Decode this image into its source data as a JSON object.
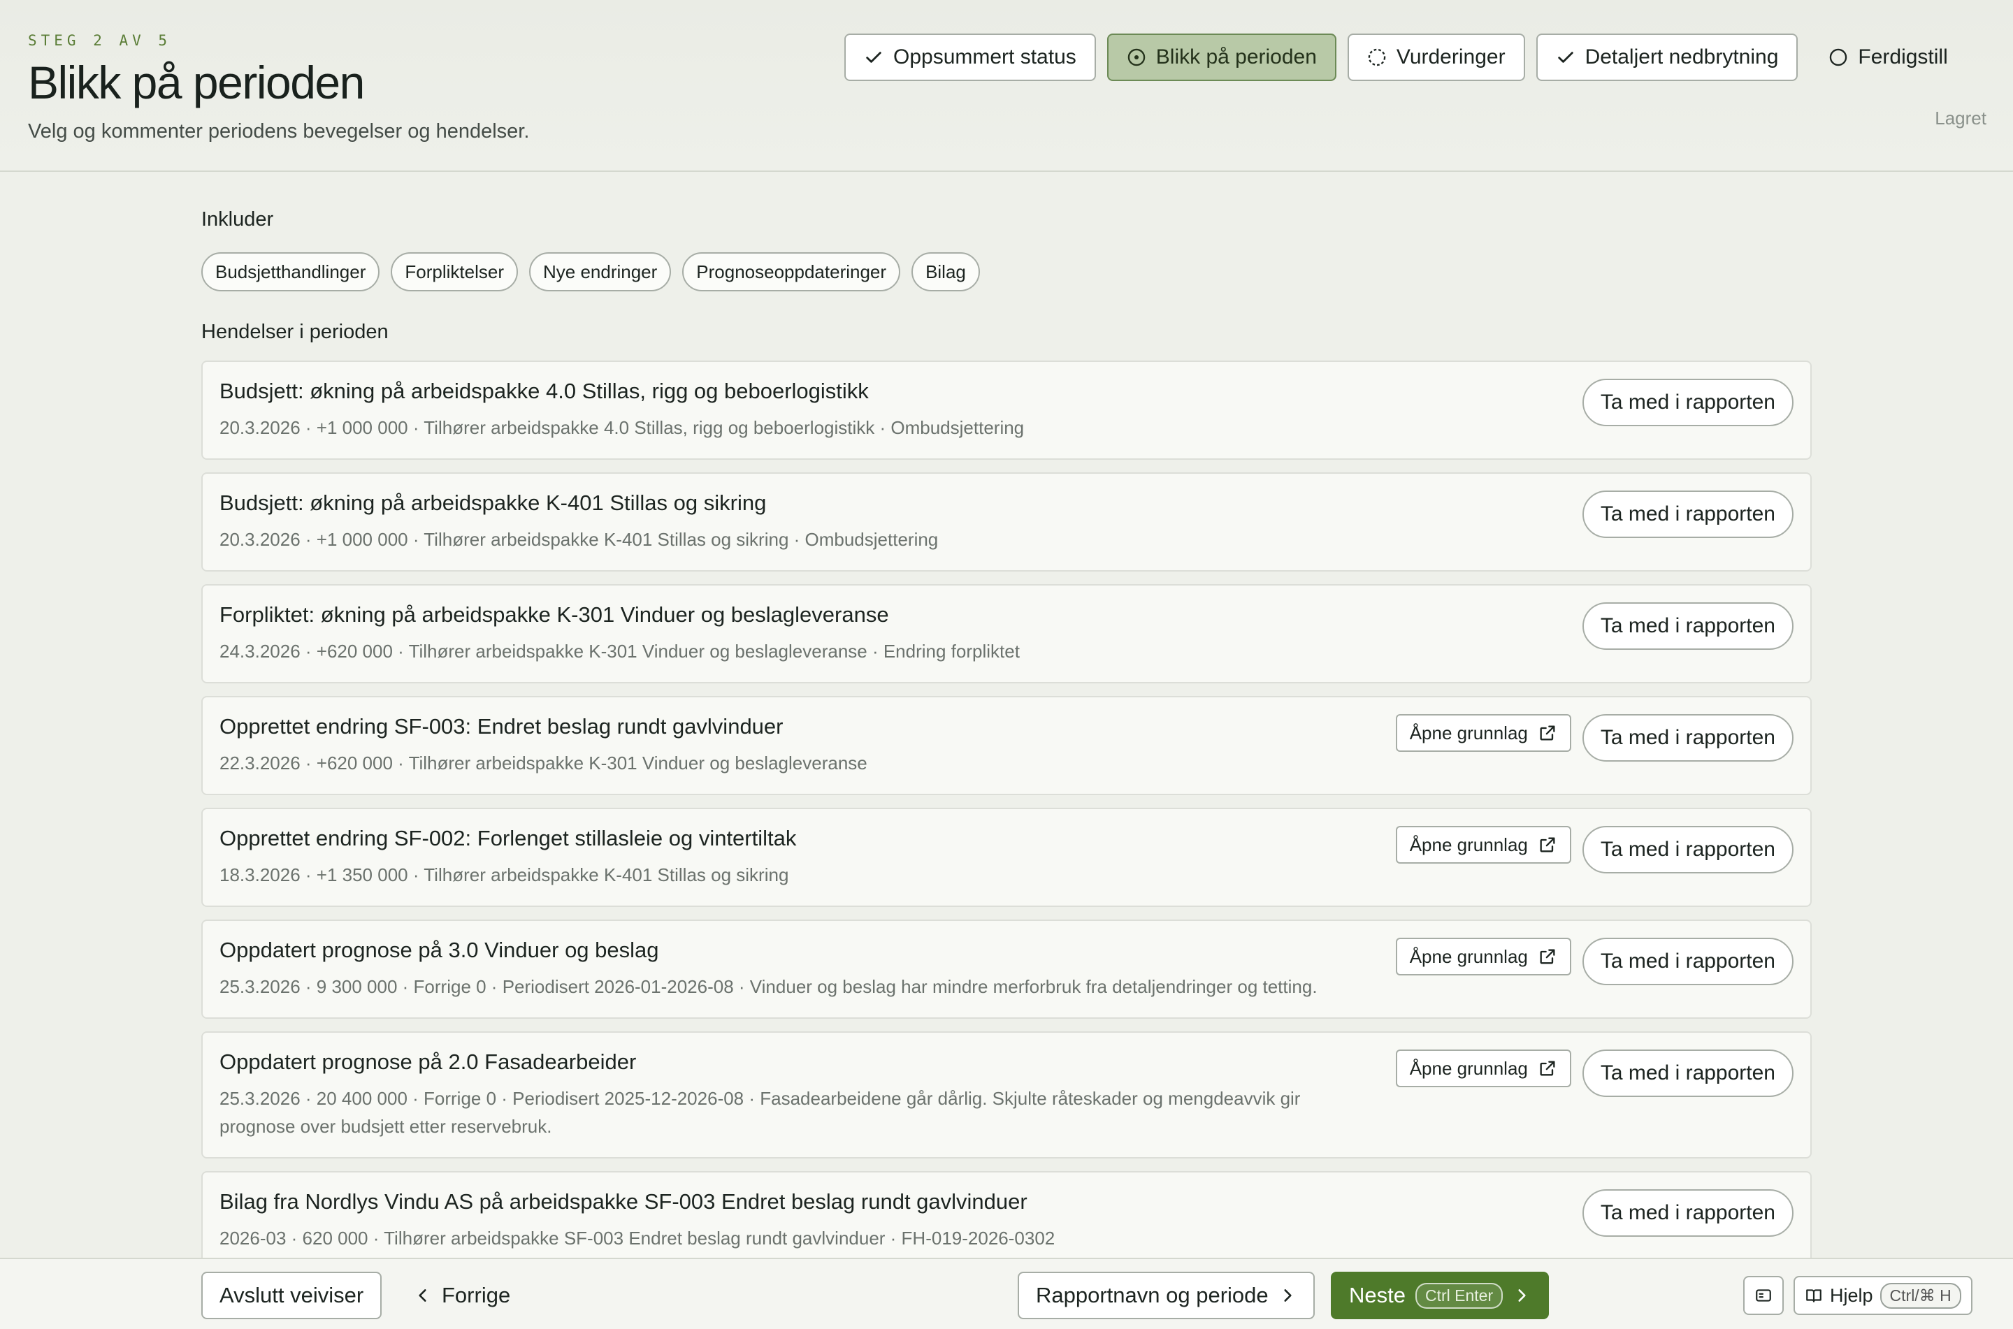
{
  "header": {
    "step_label": "STEG 2 AV 5",
    "title": "Blikk på perioden",
    "subtitle": "Velg og kommenter periodens bevegelser og hendelser.",
    "saved_status": "Lagret"
  },
  "stepper": {
    "steps": [
      {
        "label": "Oppsummert status",
        "state": "done",
        "icon": "check-icon"
      },
      {
        "label": "Blikk på perioden",
        "state": "active",
        "icon": "dot-circle-icon"
      },
      {
        "label": "Vurderinger",
        "state": "in-progress",
        "icon": "dashed-circle-icon"
      },
      {
        "label": "Detaljert nedbrytning",
        "state": "done",
        "icon": "check-icon"
      },
      {
        "label": "Ferdigstill",
        "state": "todo",
        "icon": "circle-icon"
      }
    ]
  },
  "include": {
    "title": "Inkluder",
    "chips": [
      "Budsjetthandlinger",
      "Forpliktelser",
      "Nye endringer",
      "Prognoseoppdateringer",
      "Bilag"
    ]
  },
  "events": {
    "title": "Hendelser i perioden",
    "include_label": "Ta med i rapporten",
    "open_label": "Åpne grunnlag",
    "items": [
      {
        "title": "Budsjett: økning på arbeidspakke 4.0 Stillas, rigg og beboerlogistikk",
        "meta": "20.3.2026 · +1 000 000 · Tilhører arbeidspakke 4.0 Stillas, rigg og beboerlogistikk · Ombudsjettering",
        "has_open": false
      },
      {
        "title": "Budsjett: økning på arbeidspakke K-401 Stillas og sikring",
        "meta": "20.3.2026 · +1 000 000 · Tilhører arbeidspakke K-401 Stillas og sikring · Ombudsjettering",
        "has_open": false
      },
      {
        "title": "Forpliktet: økning på arbeidspakke K-301 Vinduer og beslagleveranse",
        "meta": "24.3.2026 · +620 000 · Tilhører arbeidspakke K-301 Vinduer og beslagleveranse · Endring forpliktet",
        "has_open": false
      },
      {
        "title": "Opprettet endring SF-003: Endret beslag rundt gavlvinduer",
        "meta": "22.3.2026 · +620 000 · Tilhører arbeidspakke K-301 Vinduer og beslagleveranse",
        "has_open": true
      },
      {
        "title": "Opprettet endring SF-002: Forlenget stillasleie og vintertiltak",
        "meta": "18.3.2026 · +1 350 000 · Tilhører arbeidspakke K-401 Stillas og sikring",
        "has_open": true
      },
      {
        "title": "Oppdatert prognose på 3.0 Vinduer og beslag",
        "meta": "25.3.2026 · 9 300 000 · Forrige 0 · Periodisert 2026-01-2026-08 · Vinduer og beslag har mindre merforbruk fra detaljendringer og tetting.",
        "has_open": true
      },
      {
        "title": "Oppdatert prognose på 2.0 Fasadearbeider",
        "meta": "25.3.2026 · 20 400 000 · Forrige 0 · Periodisert 2025-12-2026-08 · Fasadearbeidene går dårlig. Skjulte råteskader og mengdeavvik gir prognose over budsjett etter reservebruk.",
        "has_open": true
      },
      {
        "title": "Bilag fra Nordlys Vindu AS på arbeidspakke SF-003 Endret beslag rundt gavlvinduer",
        "meta": "2026-03 · 620 000 · Tilhører arbeidspakke SF-003 Endret beslag rundt gavlvinduer · FH-019-2026-0302",
        "has_open": false
      }
    ]
  },
  "footer": {
    "exit_label": "Avslutt veiviser",
    "prev_label": "Forrige",
    "report_name_label": "Rapportnavn og periode",
    "next_label": "Neste",
    "next_shortcut": "Ctrl Enter",
    "help_label": "Hjelp",
    "help_shortcut": "Ctrl/⌘ H"
  },
  "colors": {
    "accent": "#4e7a2a",
    "active_step_bg": "#b8c9a7",
    "step_label": "#5a7d36"
  }
}
